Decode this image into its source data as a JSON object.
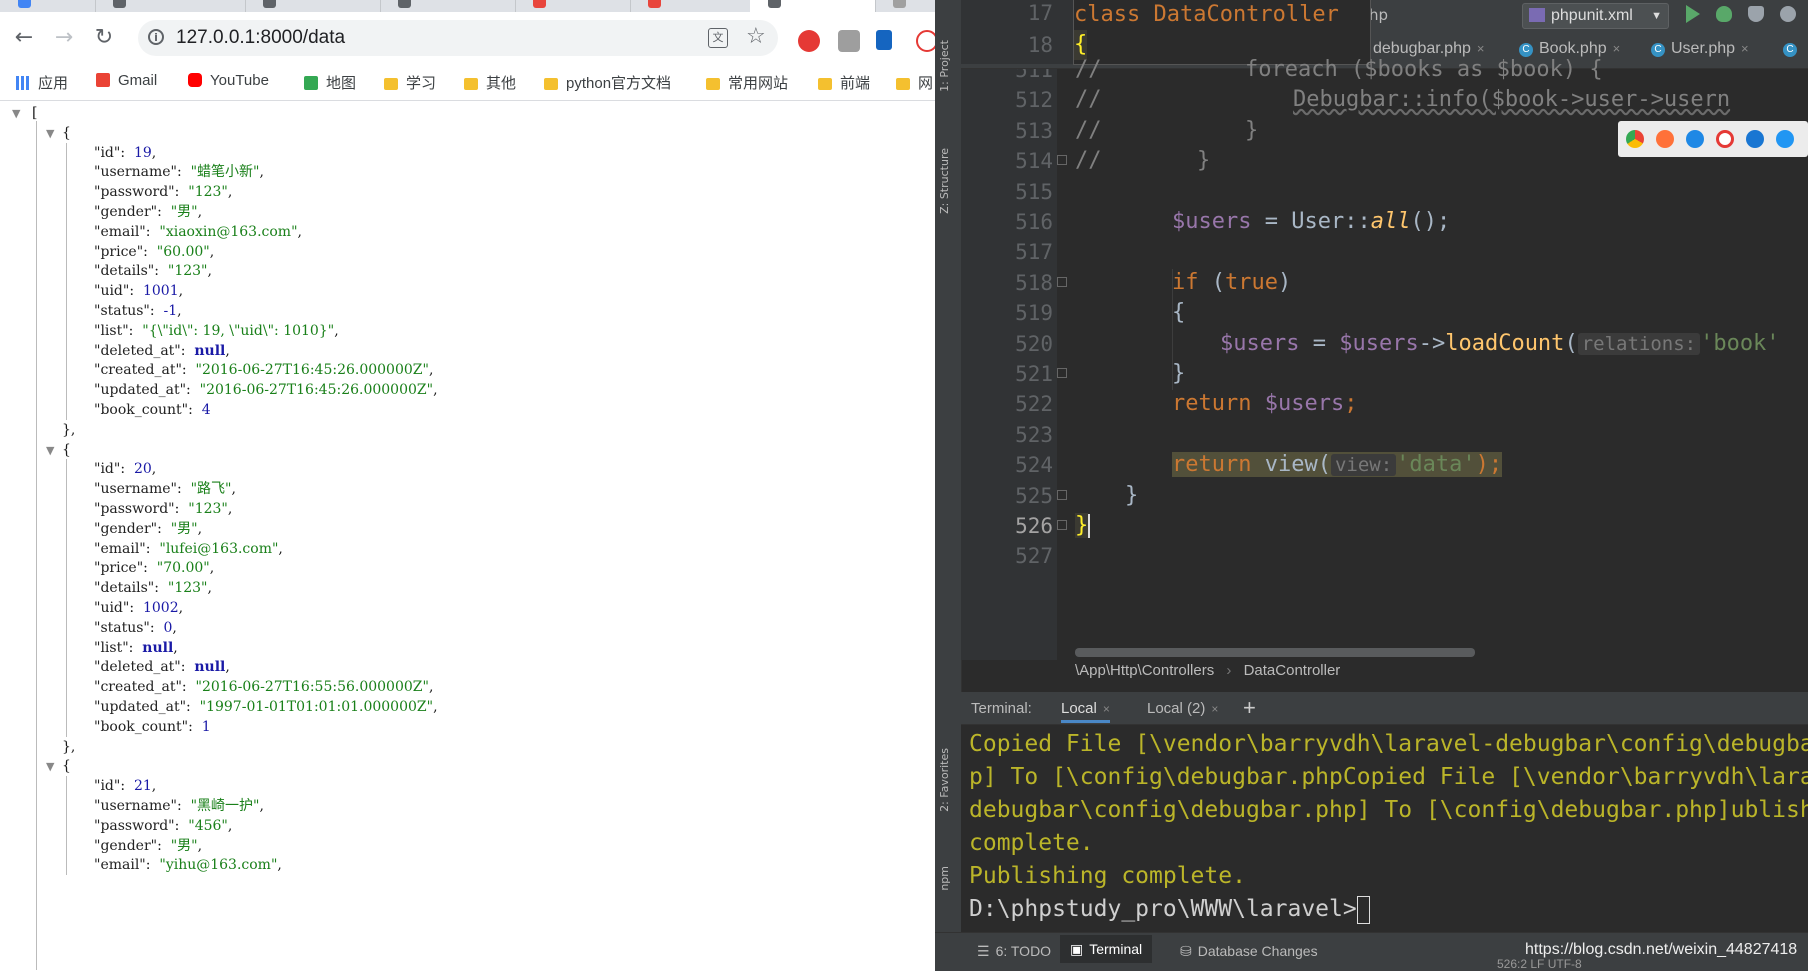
{
  "browser": {
    "url": "127.0.0.1:8000/data",
    "bookmarks": [
      {
        "label": "应用",
        "icon": "apps-grid-icon",
        "color": "#4285f4"
      },
      {
        "label": "Gmail",
        "icon": "gmail-icon",
        "color": "#ea4335"
      },
      {
        "label": "YouTube",
        "icon": "youtube-icon",
        "color": "#ff0000"
      },
      {
        "label": "地图",
        "icon": "maps-icon",
        "color": "#34a853"
      },
      {
        "label": "学习",
        "icon": "folder-icon",
        "color": "#f4c02f"
      },
      {
        "label": "其他",
        "icon": "folder-icon",
        "color": "#f4c02f"
      },
      {
        "label": "python官方文档",
        "icon": "folder-icon",
        "color": "#f4c02f"
      },
      {
        "label": "常用网站",
        "icon": "folder-icon",
        "color": "#f4c02f"
      },
      {
        "label": "前端",
        "icon": "folder-icon",
        "color": "#f4c02f"
      },
      {
        "label": "网",
        "icon": "folder-icon",
        "color": "#f4c02f"
      }
    ],
    "json": {
      "open_bracket": "[",
      "records": [
        {
          "fields": [
            {
              "key": "\"id\"",
              "value": "19",
              "type": "num"
            },
            {
              "key": "\"username\"",
              "value": "\"蜡笔小新\"",
              "type": "str"
            },
            {
              "key": "\"password\"",
              "value": "\"123\"",
              "type": "str"
            },
            {
              "key": "\"gender\"",
              "value": "\"男\"",
              "type": "str"
            },
            {
              "key": "\"email\"",
              "value": "\"xiaoxin@163.com\"",
              "type": "str"
            },
            {
              "key": "\"price\"",
              "value": "\"60.00\"",
              "type": "str"
            },
            {
              "key": "\"details\"",
              "value": "\"123\"",
              "type": "str"
            },
            {
              "key": "\"uid\"",
              "value": "1001",
              "type": "num"
            },
            {
              "key": "\"status\"",
              "value": "-1",
              "type": "num"
            },
            {
              "key": "\"list\"",
              "value": "\"{\\\"id\\\": 19, \\\"uid\\\": 1010}\"",
              "type": "str"
            },
            {
              "key": "\"deleted_at\"",
              "value": "null",
              "type": "null"
            },
            {
              "key": "\"created_at\"",
              "value": "\"2016-06-27T16:45:26.000000Z\"",
              "type": "str"
            },
            {
              "key": "\"updated_at\"",
              "value": "\"2016-06-27T16:45:26.000000Z\"",
              "type": "str"
            },
            {
              "key": "\"book_count\"",
              "value": "4",
              "type": "num"
            }
          ]
        },
        {
          "fields": [
            {
              "key": "\"id\"",
              "value": "20",
              "type": "num"
            },
            {
              "key": "\"username\"",
              "value": "\"路飞\"",
              "type": "str"
            },
            {
              "key": "\"password\"",
              "value": "\"123\"",
              "type": "str"
            },
            {
              "key": "\"gender\"",
              "value": "\"男\"",
              "type": "str"
            },
            {
              "key": "\"email\"",
              "value": "\"lufei@163.com\"",
              "type": "str"
            },
            {
              "key": "\"price\"",
              "value": "\"70.00\"",
              "type": "str"
            },
            {
              "key": "\"details\"",
              "value": "\"123\"",
              "type": "str"
            },
            {
              "key": "\"uid\"",
              "value": "1002",
              "type": "num"
            },
            {
              "key": "\"status\"",
              "value": "0",
              "type": "num"
            },
            {
              "key": "\"list\"",
              "value": "null",
              "type": "null"
            },
            {
              "key": "\"deleted_at\"",
              "value": "null",
              "type": "null"
            },
            {
              "key": "\"created_at\"",
              "value": "\"2016-06-27T16:55:56.000000Z\"",
              "type": "str"
            },
            {
              "key": "\"updated_at\"",
              "value": "\"1997-01-01T01:01:01.000000Z\"",
              "type": "str"
            },
            {
              "key": "\"book_count\"",
              "value": "1",
              "type": "num"
            }
          ]
        },
        {
          "fields": [
            {
              "key": "\"id\"",
              "value": "21",
              "type": "num"
            },
            {
              "key": "\"username\"",
              "value": "\"黑崎一护\"",
              "type": "str"
            },
            {
              "key": "\"password\"",
              "value": "\"456\"",
              "type": "str"
            },
            {
              "key": "\"gender\"",
              "value": "\"男\"",
              "type": "str"
            },
            {
              "key": "\"email\"",
              "value": "\"yihu@163.com\"",
              "type": "str"
            }
          ]
        }
      ]
    }
  },
  "ide": {
    "side_tools": [
      "1: Project",
      "Z: Structure",
      "2: Favorites",
      "npm"
    ],
    "class_header": [
      {
        "line": "17",
        "text": "class DataController"
      },
      {
        "line": "18",
        "text": "{"
      }
    ],
    "tab_fragment": "hp",
    "editor_tabs": [
      "debugbar.php",
      "Book.php",
      "User.php"
    ],
    "run_config": "phpunit.xml",
    "code_lines": [
      {
        "line": "511",
        "current": false
      },
      {
        "line": "512",
        "current": false
      },
      {
        "line": "513",
        "current": false
      },
      {
        "line": "514",
        "current": false
      },
      {
        "line": "515",
        "current": false
      },
      {
        "line": "516",
        "current": false
      },
      {
        "line": "517",
        "current": false
      },
      {
        "line": "518",
        "current": false
      },
      {
        "line": "519",
        "current": false
      },
      {
        "line": "520",
        "current": false
      },
      {
        "line": "521",
        "current": false
      },
      {
        "line": "522",
        "current": false
      },
      {
        "line": "523",
        "current": false
      },
      {
        "line": "524",
        "current": false
      },
      {
        "line": "525",
        "current": false
      },
      {
        "line": "526",
        "current": true
      },
      {
        "line": "527",
        "current": false
      }
    ],
    "code_tokens": {
      "c511_cm": "//",
      "c511_body": "foreach ($books as $book) {",
      "c512_cm": "//",
      "c512_body": "Debugbar::info($book->user->usern",
      "c513_cm": "//",
      "c513_body": "}",
      "c514_cm": "//",
      "c514_body": "}",
      "c516_var": "$users",
      "c516_eq": " = User::",
      "c516_fn": "all",
      "c516_end": "();",
      "c518_kw": "if",
      "c518_open": " (",
      "c518_true": "true",
      "c518_close": ")",
      "c519": "{",
      "c520_var1": "$users",
      "c520_eq": " = ",
      "c520_var2": "$users",
      "c520_arrow": "->",
      "c520_fn": "loadCount",
      "c520_paren": "(",
      "c520_hint": "relations:",
      "c520_str": "'book'",
      "c521": "}",
      "c522_kw": "return",
      "c522_var": " $users",
      "c522_end": ";",
      "c524_kw": "return",
      "c524_fn": " view",
      "c524_paren": "(",
      "c524_hint": "view:",
      "c524_str": "'data'",
      "c524_end": ");",
      "c525": "}",
      "c526": "}"
    },
    "breadcrumb": [
      "\\App\\Http\\Controllers",
      "DataController"
    ],
    "terminal": {
      "label": "Terminal:",
      "tabs": [
        "Local",
        "Local (2)"
      ],
      "add": "+",
      "lines": [
        "Copied File [\\vendor\\barryvdh\\laravel-debugbar\\config\\debugba",
        "p] To [\\config\\debugbar.phpCopied File [\\vendor\\barryvdh\\lara",
        "debugbar\\config\\debugbar.php] To [\\config\\debugbar.php]ublish",
        "complete.",
        "Publishing complete.",
        "D:\\phpstudy_pro\\WWW\\laravel>"
      ]
    },
    "status_tabs": [
      "6: TODO",
      "Terminal",
      "Database Changes"
    ],
    "status_info": "526:2   LF   UTF-8",
    "watermark": "https://blog.csdn.net/weixin_44827418"
  }
}
